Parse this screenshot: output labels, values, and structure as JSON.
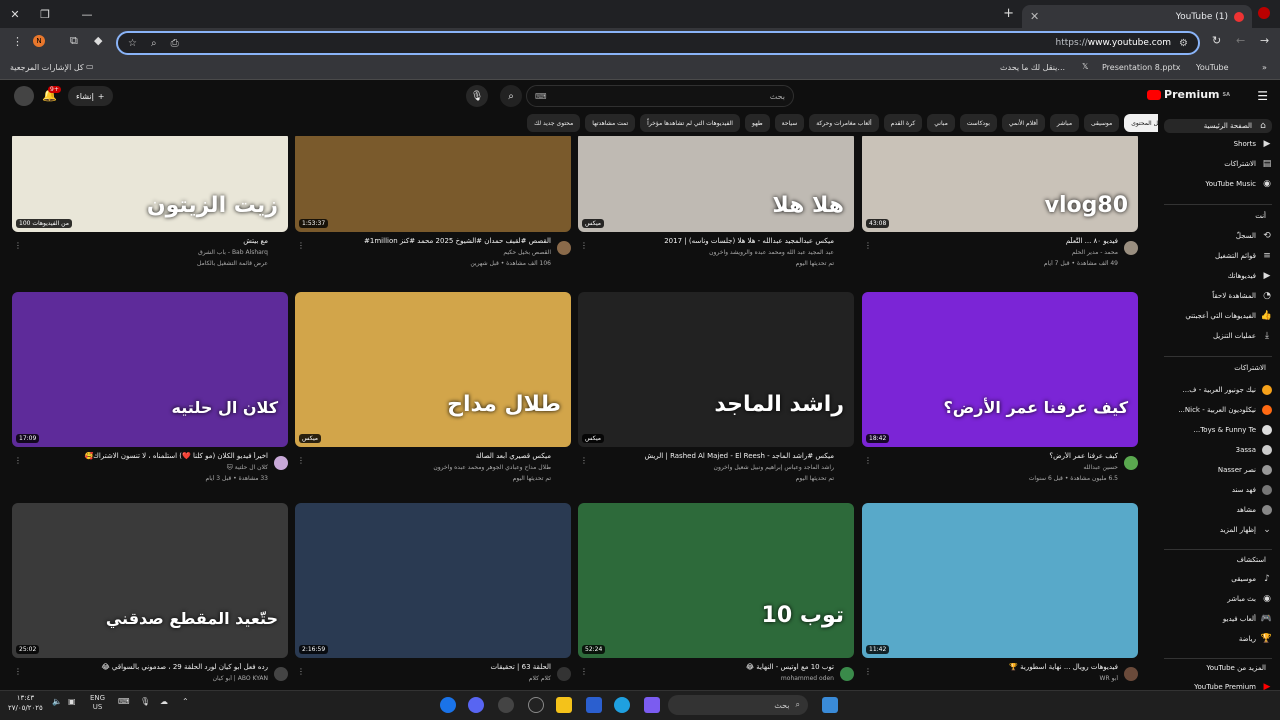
{
  "browser": {
    "tab_title": "(1) YouTube",
    "url_host": "www.youtube.com",
    "url_prefix": "https://",
    "bookmarks": [
      {
        "label": "كل الإشارات المرجعية"
      },
      {
        "label": "ينقل لك ما يحدث..."
      },
      {
        "label": "Presentation 8.pptx"
      },
      {
        "label": "YouTube"
      }
    ],
    "profile_initial": "N"
  },
  "header": {
    "logo": "Premium",
    "logo_sup": "SA",
    "search_placeholder": "بحث",
    "create_label": "إنشاء",
    "bell_count": "9+"
  },
  "chips": [
    "كل المحتوى",
    "موسيقى",
    "مباشر",
    "أفلام الأنمي",
    "بودكاست",
    "مباني",
    "كرة القدم",
    "ألعاب مغامرات وحركة",
    "سياحة",
    "طهو",
    "الفيديوهات التي لم تشاهدها مؤخراً",
    "تمت مشاهدتها",
    "محتوى جديد لك"
  ],
  "sidebar": {
    "main": [
      {
        "label": "الصفحة الرئيسية",
        "icon": "home-icon"
      },
      {
        "label": "Shorts",
        "icon": "shorts-icon"
      },
      {
        "label": "الاشتراكات",
        "icon": "subscriptions-icon"
      },
      {
        "label": "YouTube Music",
        "icon": "music-icon"
      }
    ],
    "you_header": "أنت",
    "you": [
      {
        "label": "السجلّ",
        "icon": "history-icon"
      },
      {
        "label": "قوائم التشغيل",
        "icon": "playlist-icon"
      },
      {
        "label": "فيديوهاتك",
        "icon": "your-videos-icon"
      },
      {
        "label": "المشاهدة لاحقاً",
        "icon": "watch-later-icon"
      },
      {
        "label": "الفيديوهات التي أعجبتني",
        "icon": "like-icon"
      },
      {
        "label": "عمليات التنزيل",
        "icon": "download-icon"
      }
    ],
    "subs_header": "الاشتراكات",
    "subs": [
      {
        "label": "نيك جونيور العربية - ف...",
        "color": "#f7a21b"
      },
      {
        "label": "نيكلوديون العربية - Nick...",
        "color": "#ff6a13"
      },
      {
        "label": "Toys & Funny Te...",
        "color": "#ddd"
      },
      {
        "label": "3assa",
        "color": "#ccc"
      },
      {
        "label": "نصر Nasser",
        "color": "#999"
      },
      {
        "label": "فهد سند",
        "color": "#777"
      },
      {
        "label": "مشاهد",
        "color": "#888"
      },
      {
        "label": "إظهار المزيد",
        "color": ""
      }
    ],
    "explore_header": "استكشاف",
    "explore": [
      {
        "label": "موسيقى",
        "icon": "music-note-icon"
      },
      {
        "label": "بث مباشر",
        "icon": "live-icon"
      },
      {
        "label": "ألعاب فيديو",
        "icon": "gaming-icon"
      },
      {
        "label": "رياضة",
        "icon": "trophy-icon"
      }
    ],
    "more_header": "المزيد من YouTube",
    "more": [
      {
        "label": "YouTube Premium"
      }
    ]
  },
  "videos": [
    {
      "title": "فيديو ٨٠ ... التَّعلُّم",
      "channel": "محمد - مدير الحلم",
      "meta": "49 ألف مشاهدة • قبل 7 أيام",
      "duration": "43:08",
      "thumb_text": "vlog80",
      "bg": "#c9c2b8",
      "avatar": "#9a8f80"
    },
    {
      "title": "ميكس عبدالمجيد عبدالله - هلا هلا (جلسات وناسه) | 2017",
      "channel": "عبد المجيد عبد الله ومحمد عبده والرويشد وآخرون",
      "meta": "تم تحديثها اليوم",
      "duration": "ميكس",
      "thumb_text": "هلا هلا",
      "bg": "#bfbab3",
      "avatar": ""
    },
    {
      "title": "القصص #لقيف حمدان #الشيوخ 2025 محمد #كنز 1million#",
      "channel": "القصص بخيل حكيم",
      "meta": "106 ألف مشاهدة • قبل شهرين",
      "duration": "1:53:37",
      "thumb_text": "",
      "bg": "#7a5a2c",
      "avatar": "#8a6a4a"
    },
    {
      "title": "مع بيتش",
      "channel": "Bab Alsharq - باب الشرق",
      "meta": "عرض قائمة التشغيل بالكامل",
      "duration": "100 من الفيديوهات",
      "thumb_text": "زيت الزيتون",
      "bg": "#e9e6d8",
      "avatar": ""
    },
    {
      "title": "كيف عرفنا عمر الأرض؟",
      "channel": "حسين عبدالله",
      "meta": "6.5 مليون مشاهدة • قبل 6 سنوات",
      "duration": "18:42",
      "thumb_text": "كيف عرفنا عمر الأرض؟",
      "bg": "#7b25d6",
      "avatar": "#5aa84f"
    },
    {
      "title": "ميكس #راشد الماجد - Rashed Al Majed - El Reesh | الريش",
      "channel": "راشد الماجد وعباس إبراهيم ونبيل شعيل وآخرون",
      "meta": "تم تحديثها اليوم",
      "duration": "ميكس",
      "thumb_text": "راشد الماجد",
      "bg": "#222",
      "avatar": ""
    },
    {
      "title": "ميكس قصيري أبعد الصالة",
      "channel": "طلال مداح وعبادي الجوهر ومحمد عبده وآخرون",
      "meta": "تم تحديثها اليوم",
      "duration": "ميكس",
      "thumb_text": "طلال مداح",
      "bg": "#d2a54a",
      "avatar": ""
    },
    {
      "title": "اخيراً فيديو الكلان (مو كلنا ❤️) استلمناه ، لا تنسون الاشتراك🥰",
      "channel": "كلان ال حلتية 🐱",
      "meta": "33 مشاهدة • قبل 3 أيام",
      "duration": "17:09",
      "thumb_text": "كلان ال حلتيه",
      "bg": "#5e2b9a",
      "avatar": "#c8a8d8"
    },
    {
      "title": "فيديوهات رويال ... نهاية اسطورية 🏆",
      "channel": "أبو WR",
      "meta": "",
      "duration": "11:42",
      "thumb_text": "",
      "bg": "#58a9c9",
      "avatar": "#6a4a3a"
    },
    {
      "title": "توب 10 مع اوتيس - النهاية 😂",
      "channel": "mohammed oden",
      "meta": "",
      "duration": "52:24",
      "thumb_text": "توب 10",
      "bg": "#2d6a3a",
      "avatar": "#3a8a4a"
    },
    {
      "title": "الحلقة 63 | تحقيقات",
      "channel": "كلام كلام",
      "meta": "",
      "duration": "2:16:59",
      "thumb_text": "",
      "bg": "#2a3a52",
      "avatar": "#333"
    },
    {
      "title": "رده فعل أبو كيان لورد الحلقة 29 ، صدموني بالسواقي 😂",
      "channel": "ABO KYAN | أبو كيان",
      "meta": "",
      "duration": "25:02",
      "thumb_text": "حتّعيد المقطع صدقني",
      "bg": "#3a3a3a",
      "avatar": "#444"
    }
  ],
  "taskbar": {
    "search_label": "بحث",
    "lang": "ENG",
    "region": "US",
    "time": "١٣:٤٣",
    "date": "٢٧/٠٥/٢٠٢٥"
  }
}
